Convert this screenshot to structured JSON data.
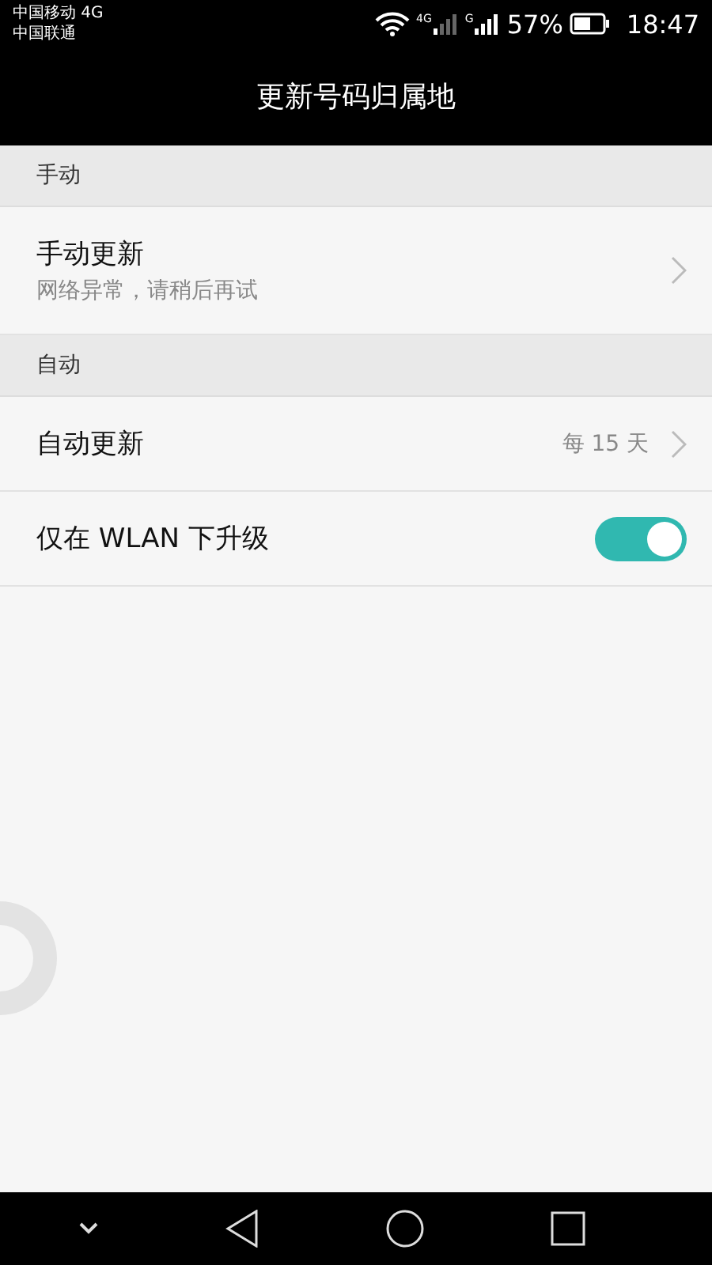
{
  "status_bar": {
    "carriers": [
      "中国移动 4G",
      "中国联通"
    ],
    "sim_labels": [
      "4G",
      "G"
    ],
    "battery": "57%",
    "time": "18:47"
  },
  "title": "更新号码归属地",
  "sections": [
    {
      "header": "手动",
      "rows": [
        {
          "kind": "link",
          "title": "手动更新",
          "subtitle": "网络异常，请稍后再试"
        }
      ]
    },
    {
      "header": "自动",
      "rows": [
        {
          "kind": "link",
          "title": "自动更新",
          "value": "每 15 天"
        },
        {
          "kind": "switch",
          "title": "仅在 WLAN 下升级",
          "on": true
        }
      ]
    }
  ]
}
